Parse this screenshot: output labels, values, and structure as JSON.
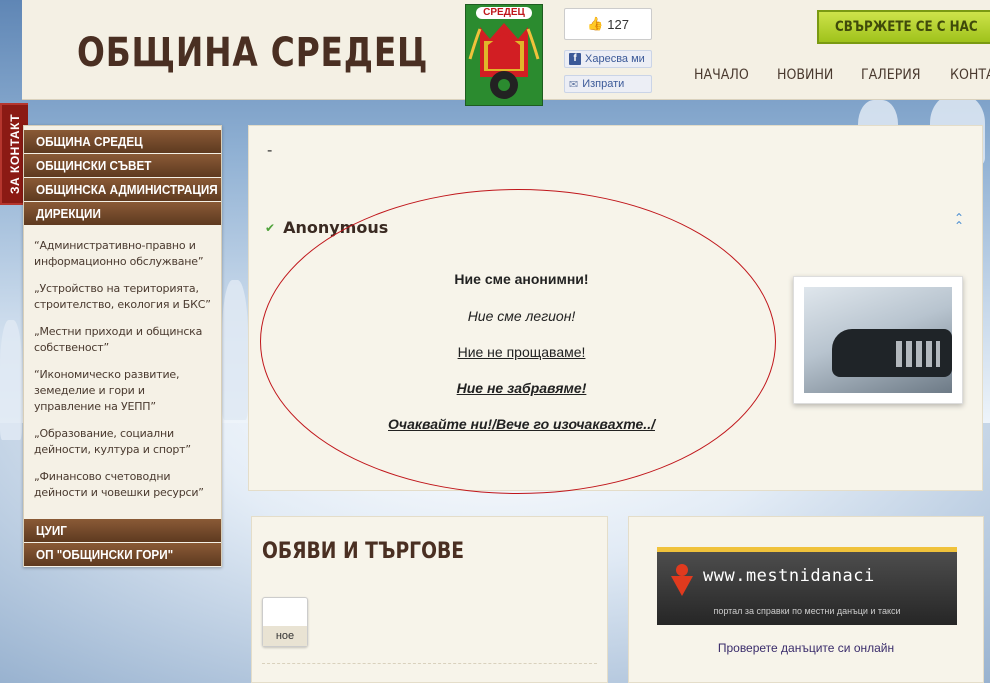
{
  "header": {
    "site_title": "ОБЩИНА СРЕДЕЦ",
    "logo_label": "СРЕДЕЦ",
    "facebook": {
      "like_count": "127",
      "like_label": "Харесва ми",
      "send_label": "Изпрати"
    },
    "contact_button": "СВЪРЖЕТЕ СЕ С НАС",
    "nav": [
      "НАЧАЛО",
      "НОВИНИ",
      "ГАЛЕРИЯ",
      "КОНТАКТИ"
    ]
  },
  "side_tab": "ЗА КОНТАКТ",
  "left_menu": {
    "top_items": [
      "ОБЩИНА СРЕДЕЦ",
      "ОБЩИНСКИ СЪВЕТ",
      "ОБЩИНСКА АДМИНИСТРАЦИЯ",
      "ДИРЕКЦИИ"
    ],
    "sub_items": [
      "“Административно-правно и информационно обслужване”",
      "„Устройство на територията, строителство, екология и БКС”",
      "„Местни приходи и общинска собственост”",
      "“Икономическо развитие, земеделие и гори и управление на УЕПП”",
      "„Образование, социални дейности, култура и спорт”",
      "„Финансово счетоводни дейности и човешки ресурси”"
    ],
    "bottom_items": [
      "ЦУИГ",
      "ОП \"ОБЩИНСКИ ГОРИ\""
    ]
  },
  "article": {
    "dash": "-",
    "title": "Anonymous",
    "lines": [
      "Ние сме анонимни!",
      "Ние сме легион!",
      "Ние не прощаваме!",
      "Ние не забравяме!",
      "Очаквайте ни!/Вече го изочаквахте../"
    ]
  },
  "ads": {
    "title": "ОБЯВИ И ТЪРГОВЕ",
    "thumb_label": "ное"
  },
  "info": {
    "banner_text": "www.mestnidanaci",
    "banner_subtext": "портал за справки по местни данъци и такси",
    "link": "Проверете данъците си онлайн"
  }
}
